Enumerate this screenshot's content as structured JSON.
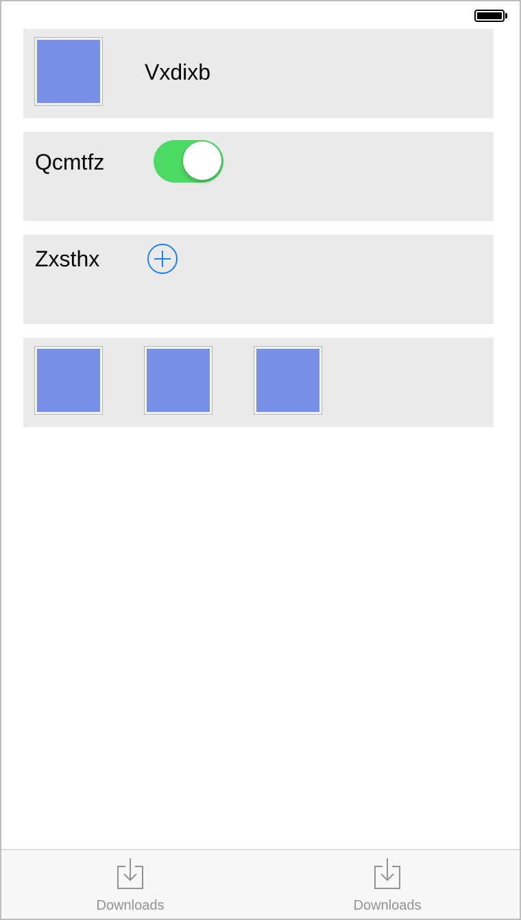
{
  "status_bar": {
    "battery_icon": "battery-full-icon"
  },
  "rows": [
    {
      "type": "image-label",
      "label": "Vxdixb",
      "image_color": "#7890e5"
    },
    {
      "type": "toggle",
      "label": "Qcmtfz",
      "toggle_on": true,
      "toggle_color": "#4cd964"
    },
    {
      "type": "add",
      "label": "Zxsthx",
      "add_icon": "plus-circle-icon",
      "accent": "#1a82f0"
    },
    {
      "type": "image-strip",
      "image_count": 3,
      "image_color": "#7890e5"
    }
  ],
  "tabbar": {
    "tabs": [
      {
        "label": "Downloads",
        "icon": "download-tray-icon"
      },
      {
        "label": "Downloads",
        "icon": "download-tray-icon"
      }
    ]
  }
}
